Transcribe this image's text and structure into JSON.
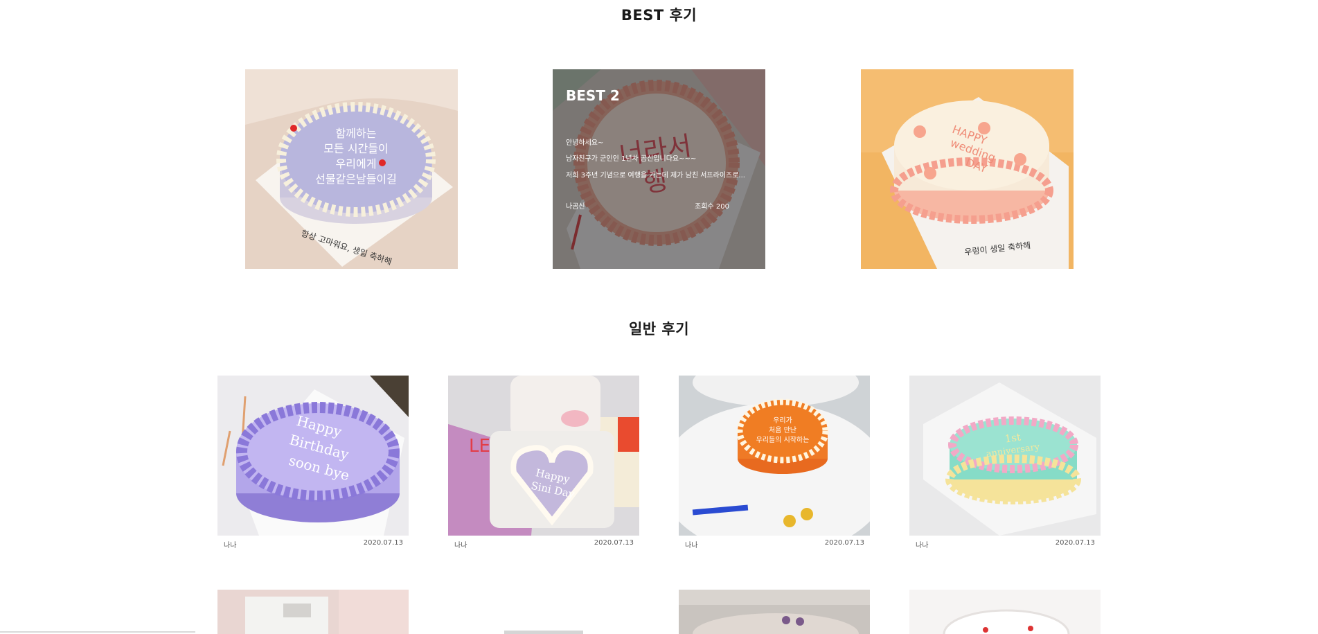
{
  "sections": {
    "best_title": "BEST 후기",
    "general_title": "일반 후기"
  },
  "best_reviews": [
    {
      "cake_text": "함께하는 모든 시간들이 우리에게 선물 같은날들이길",
      "board_text": "항상 고마워요, 생일 축하해"
    },
    {
      "rank": "BEST 2",
      "line1": "안녕하세요~",
      "line2": "남자친구가 군인인 1년차 곰신입니다요~~~",
      "line3": "저희 3주년 기념으로 여행을 가는데 제가 남친 서프라이즈로...",
      "author": "나곰신",
      "views": "조회수 200",
      "cake_text": "너라서 행"
    },
    {
      "cake_text": "HAPPY wedding DAY",
      "board_text": "우렁이 생일 축하해"
    }
  ],
  "general_reviews": [
    {
      "author": "나나",
      "date": "2020.07.13",
      "cake_text": "Happy Birthday soon bye"
    },
    {
      "author": "나나",
      "date": "2020.07.13",
      "cake_text": "Happy Sini Day",
      "box_text": "LEO"
    },
    {
      "author": "나나",
      "date": "2020.07.13",
      "cake_text": "우리가 처음 만난 우리들의 시작하는"
    },
    {
      "author": "나나",
      "date": "2020.07.13",
      "cake_text": "1st anniversary"
    }
  ],
  "colors": {
    "title": "#1a1a1a",
    "overlay": "rgba(45,45,45,0.55)",
    "meta_text": "#555555"
  }
}
